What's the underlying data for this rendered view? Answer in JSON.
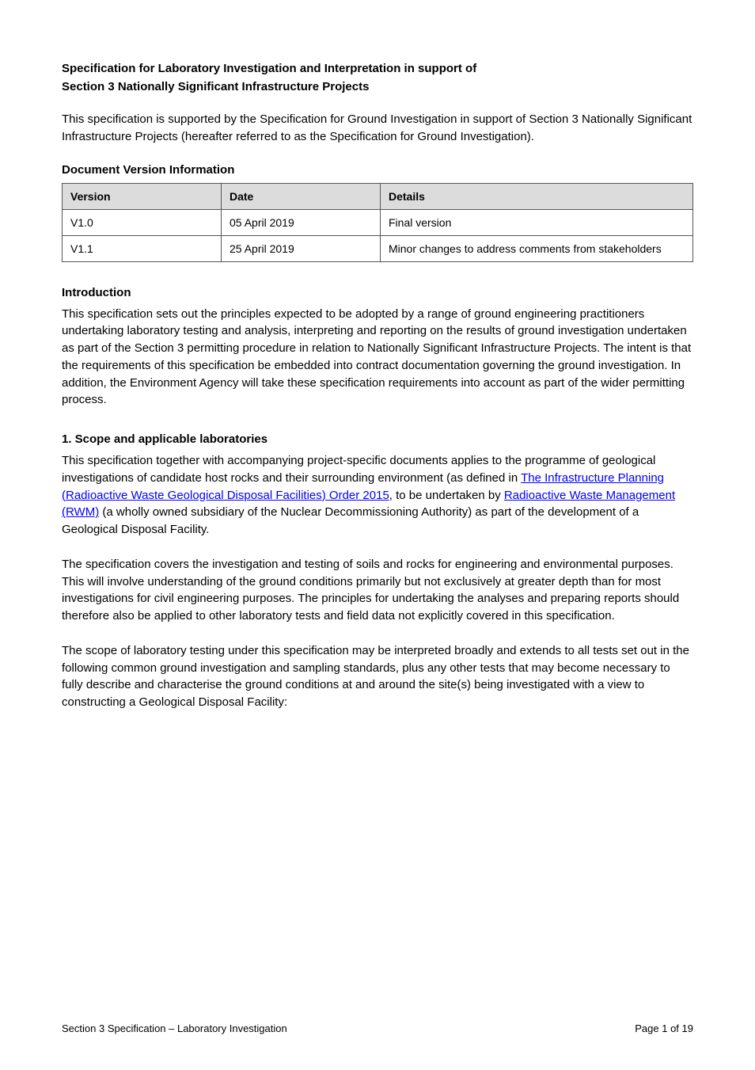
{
  "header": {
    "title_line1": "Specification for Laboratory Investigation and Interpretation in support of",
    "title_line2": "Section 3 Nationally Significant Infrastructure Projects"
  },
  "intro_para": "This specification is supported by the Specification for Ground Investigation in support of Section 3 Nationally Significant Infrastructure Projects (hereafter referred to as the Specification for Ground Investigation).",
  "version_label": "Document Version Information",
  "table": {
    "headers": [
      "Version",
      "Date",
      "Details"
    ],
    "rows": [
      [
        "V1.0",
        "05 April 2019",
        "Final version"
      ],
      [
        "V1.1",
        "25 April 2019",
        "Minor changes to address comments from stakeholders"
      ]
    ]
  },
  "intro_heading": "Introduction",
  "intro_body": "This specification sets out the principles expected to be adopted by a range of ground engineering practitioners undertaking laboratory testing and analysis, interpreting and reporting on the results of ground investigation undertaken as part of the Section 3 permitting procedure in relation to Nationally Significant Infrastructure Projects. The intent is that the requirements of this specification be embedded into contract documentation governing the ground investigation. In addition, the Environment Agency will take these specification requirements into account as part of the wider permitting process.",
  "section1": {
    "heading": "1. Scope and applicable laboratories",
    "para1_prefix": "This specification together with accompanying project-specific documents applies to the programme of geological investigations of candidate host rocks and their surrounding environment (as defined in ",
    "link1": "The Infrastructure Planning (Radioactive Waste Geological Disposal Facilities) Order 2015",
    "para1_mid": ", to be undertaken by ",
    "link2": "Radioactive Waste Management (RWM)",
    "para1_suffix": " (a wholly owned subsidiary of the Nuclear Decommissioning Authority) as part of the development of a Geological Disposal Facility.",
    "para2": "The specification covers the investigation and testing of soils and rocks for engineering and environmental purposes. This will involve understanding of the ground conditions primarily but not exclusively at greater depth than for most investigations for civil engineering purposes. The principles for undertaking the analyses and preparing reports should therefore also be applied to other laboratory tests and field data not explicitly covered in this specification.",
    "para3": "The scope of laboratory testing under this specification may be interpreted broadly and extends to all tests set out in the following common ground investigation and sampling standards, plus any other tests that may become necessary to fully describe and characterise the ground conditions at and around the site(s) being investigated with a view to constructing a Geological Disposal Facility:"
  },
  "footer": {
    "left": "Section 3 Specification – Laboratory Investigation",
    "right": "Page 1 of 19"
  }
}
